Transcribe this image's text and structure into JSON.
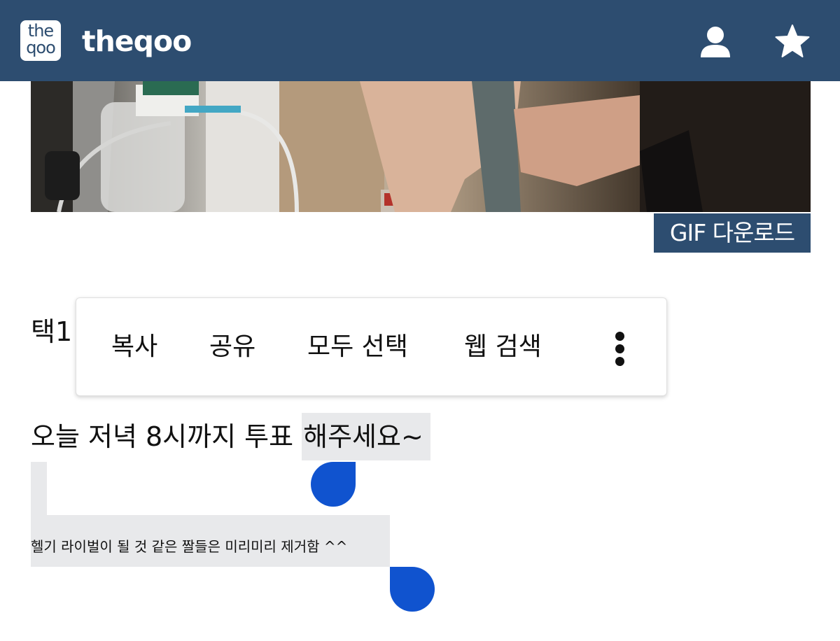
{
  "header": {
    "logo_top": "the",
    "logo_bottom": "qoo",
    "brand": "theqoo",
    "icons": {
      "account": "user-icon",
      "favorite": "star-icon"
    },
    "color": "#2d4d70"
  },
  "media": {
    "gif_download_label": "GIF 다운로드"
  },
  "post": {
    "line1_visible": "택1",
    "line2_prefix": "오늘 저녁 8시까지 투표 ",
    "line2_selected": "해주세요~",
    "line3": "헬기 라이벌이 될 것 같은 짤들은 미리미리 제거함 ^^"
  },
  "context_menu": {
    "items": [
      "복사",
      "공유",
      "모두 선택",
      "웹 검색"
    ],
    "more_icon": "more-vertical-icon"
  },
  "colors": {
    "selection_bg": "#e8e9eb",
    "handle": "#1053cf"
  }
}
